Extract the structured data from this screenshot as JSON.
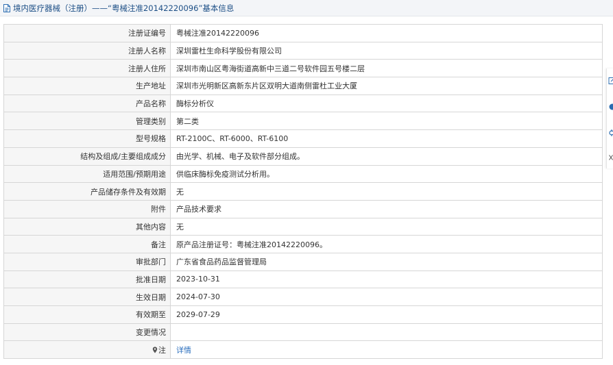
{
  "header": {
    "title": "境内医疗器械（注册）——“粤械注准20142220096”基本信息"
  },
  "table": {
    "rows": [
      {
        "label": "注册证编号",
        "value": "粤械注准20142220096"
      },
      {
        "label": "注册人名称",
        "value": "深圳雷杜生命科学股份有限公司"
      },
      {
        "label": "注册人住所",
        "value": "深圳市南山区粤海街道高新中三道二号软件园五号楼二层"
      },
      {
        "label": "生产地址",
        "value": "深圳市光明新区高新东片区双明大道南侧雷杜工业大厦"
      },
      {
        "label": "产品名称",
        "value": "酶标分析仪"
      },
      {
        "label": "管理类别",
        "value": "第二类"
      },
      {
        "label": "型号规格",
        "value": "RT-2100C、RT-6000、RT-6100"
      },
      {
        "label": "结构及组成/主要组成成分",
        "value": "由光学、机械、电子及软件部分组成。"
      },
      {
        "label": "适用范围/预期用途",
        "value": "供临床酶标免疫测试分析用。"
      },
      {
        "label": "产品储存条件及有效期",
        "value": "无"
      },
      {
        "label": "附件",
        "value": "产品技术要求"
      },
      {
        "label": "其他内容",
        "value": "无"
      },
      {
        "label": "备注",
        "value": "原产品注册证号：粤械注准20142220096。"
      },
      {
        "label": "审批部门",
        "value": "广东省食品药品监督管理局"
      },
      {
        "label": "批准日期",
        "value": "2023-10-31"
      },
      {
        "label": "生效日期",
        "value": "2024-07-30"
      },
      {
        "label": "有效期至",
        "value": "2029-07-29"
      },
      {
        "label": "变更情况",
        "value": ""
      },
      {
        "label": "注",
        "value": "详情"
      }
    ]
  },
  "icons": {
    "title": "document-icon",
    "note": "map-pin-icon",
    "side": [
      "edit-icon",
      "circle-icon",
      "share-icon",
      "close-icon"
    ]
  },
  "colors": {
    "title_text": "#1d4f86",
    "link": "#2a6ebd",
    "label_bg": "#f6f6f6",
    "border": "#d6d6d6"
  }
}
